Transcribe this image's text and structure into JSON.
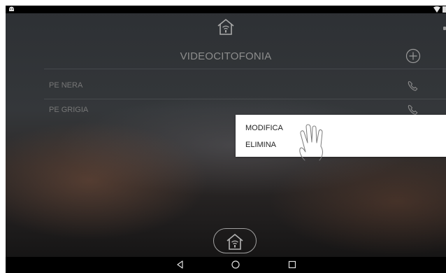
{
  "header": {
    "title": "VIDEOCITOFONIA",
    "icons": {
      "home": "home-wifi-icon",
      "add": "plus-circle-icon"
    }
  },
  "list": {
    "items": [
      {
        "label": "PE NERA",
        "icon": "phone-icon"
      },
      {
        "label": "PE GRIGIA",
        "icon": "phone-icon"
      }
    ]
  },
  "context_menu": {
    "items": [
      {
        "label": "MODIFICA"
      },
      {
        "label": "ELIMINA"
      }
    ]
  },
  "status_bar": {
    "icons": [
      "android-icon",
      "wifi-icon",
      "battery-icon"
    ]
  },
  "nav_bar": {
    "buttons": [
      "back-icon",
      "home-icon",
      "recents-icon"
    ]
  },
  "colors": {
    "menu_bg": "#ffffff",
    "text_muted": "#8d8d8d",
    "bar_bg": "#000000"
  }
}
